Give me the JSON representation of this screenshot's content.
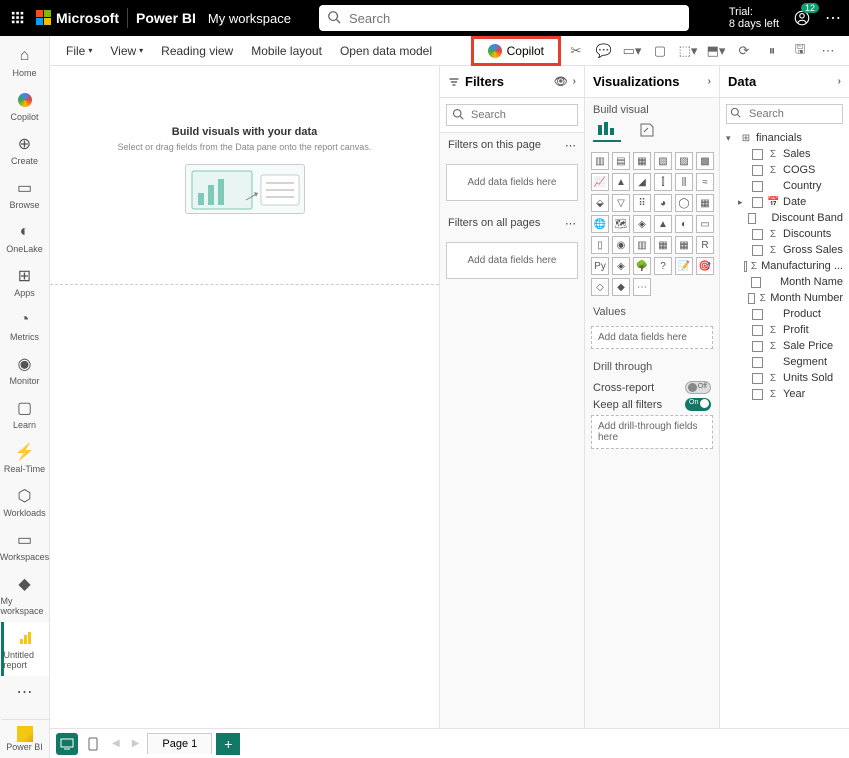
{
  "topbar": {
    "brand_ms": "Microsoft",
    "brand_pbi": "Power BI",
    "workspace": "My workspace",
    "search_placeholder": "Search",
    "trial_line1": "Trial:",
    "trial_line2": "8 days left",
    "notif_count": "12"
  },
  "leftrail": [
    {
      "label": "Home",
      "icon": "home"
    },
    {
      "label": "Copilot",
      "icon": "copilot"
    },
    {
      "label": "Create",
      "icon": "plus"
    },
    {
      "label": "Browse",
      "icon": "browse"
    },
    {
      "label": "OneLake",
      "icon": "onelake"
    },
    {
      "label": "Apps",
      "icon": "apps"
    },
    {
      "label": "Metrics",
      "icon": "metrics"
    },
    {
      "label": "Monitor",
      "icon": "monitor"
    },
    {
      "label": "Learn",
      "icon": "learn"
    },
    {
      "label": "Real-Time",
      "icon": "realtime"
    },
    {
      "label": "Workloads",
      "icon": "workloads"
    },
    {
      "label": "Workspaces",
      "icon": "workspaces"
    },
    {
      "label": "My workspace",
      "icon": "myws"
    },
    {
      "label": "Untitled report",
      "icon": "report",
      "active": true
    }
  ],
  "leftrail_bottom": "Power BI",
  "ribbon": {
    "file": "File",
    "view": "View",
    "reading_view": "Reading view",
    "mobile_layout": "Mobile layout",
    "open_data_model": "Open data model",
    "copilot": "Copilot"
  },
  "canvas": {
    "heading": "Build visuals with your data",
    "sub": "Select or drag fields from the Data pane onto the report canvas."
  },
  "filters": {
    "title": "Filters",
    "search_placeholder": "Search",
    "section_page": "Filters on this page",
    "section_all": "Filters on all pages",
    "drop_text": "Add data fields here"
  },
  "viz": {
    "title": "Visualizations",
    "build": "Build visual",
    "values": "Values",
    "values_drop": "Add data fields here",
    "drill": "Drill through",
    "cross_report": "Cross-report",
    "keep_filters": "Keep all filters",
    "drill_drop": "Add drill-through fields here",
    "off": "Off",
    "on": "On"
  },
  "data": {
    "title": "Data",
    "search_placeholder": "Search",
    "table": "financials",
    "fields": [
      {
        "name": "Sales",
        "type": "sum"
      },
      {
        "name": "COGS",
        "type": "sum"
      },
      {
        "name": "Country",
        "type": "text"
      },
      {
        "name": "Date",
        "type": "date",
        "expandable": true
      },
      {
        "name": "Discount Band",
        "type": "text"
      },
      {
        "name": "Discounts",
        "type": "sum"
      },
      {
        "name": "Gross Sales",
        "type": "sum"
      },
      {
        "name": "Manufacturing ...",
        "type": "sum"
      },
      {
        "name": "Month Name",
        "type": "text"
      },
      {
        "name": "Month Number",
        "type": "sum"
      },
      {
        "name": "Product",
        "type": "text"
      },
      {
        "name": "Profit",
        "type": "sum"
      },
      {
        "name": "Sale Price",
        "type": "sum"
      },
      {
        "name": "Segment",
        "type": "text"
      },
      {
        "name": "Units Sold",
        "type": "sum"
      },
      {
        "name": "Year",
        "type": "sum"
      }
    ]
  },
  "pagetabs": {
    "page1": "Page 1"
  }
}
